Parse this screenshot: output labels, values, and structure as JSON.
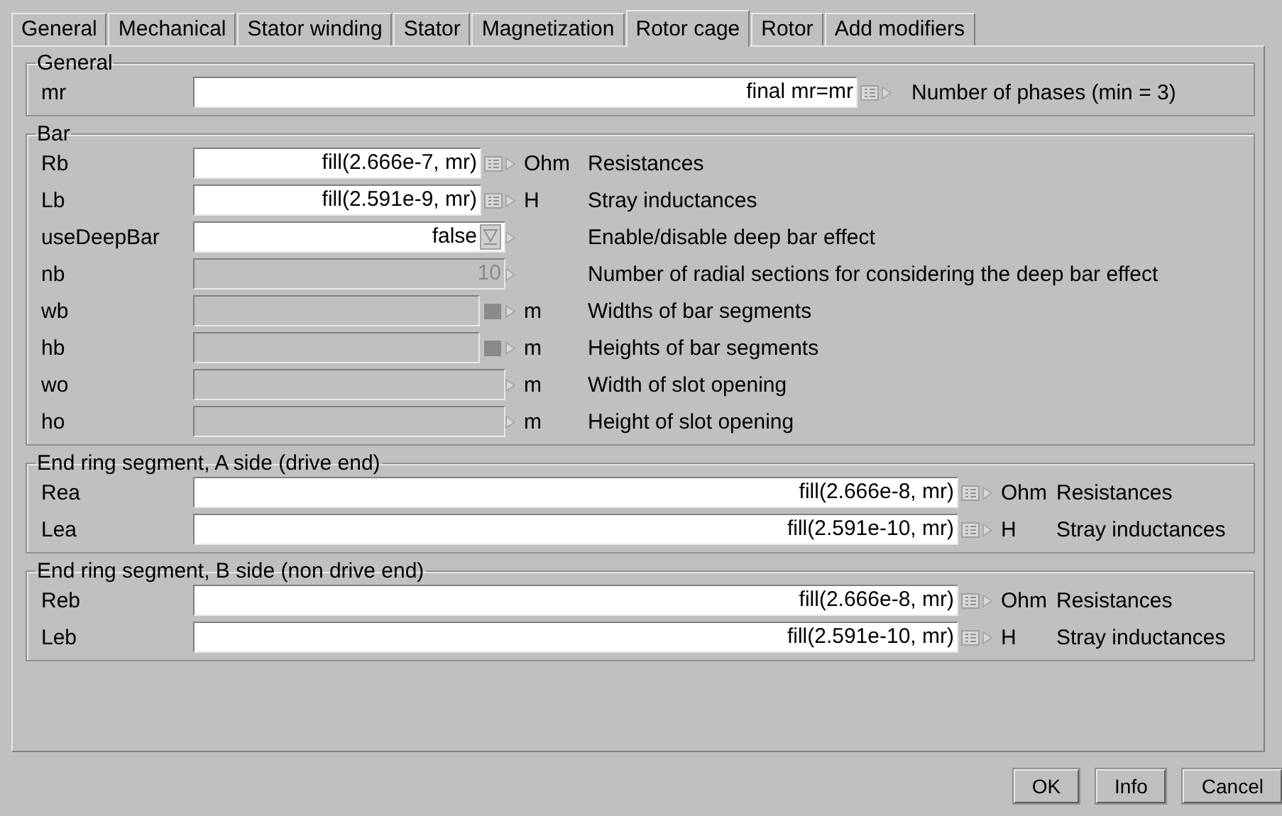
{
  "tabs": [
    {
      "label": "General",
      "selected": false
    },
    {
      "label": "Mechanical",
      "selected": false
    },
    {
      "label": "Stator winding",
      "selected": false
    },
    {
      "label": "Stator",
      "selected": false
    },
    {
      "label": "Magnetization",
      "selected": false
    },
    {
      "label": "Rotor cage",
      "selected": true
    },
    {
      "label": "Rotor",
      "selected": false
    },
    {
      "label": "Add modifiers",
      "selected": false
    }
  ],
  "groups": [
    {
      "title": "General",
      "kind": "wide",
      "rows": [
        {
          "name": "mr",
          "kind": "text",
          "value": "final mr=mr",
          "disabled": false,
          "description": "Number of phases (min = 3)"
        }
      ]
    },
    {
      "title": "Bar",
      "kind": "narrow",
      "rows": [
        {
          "name": "Rb",
          "kind": "text",
          "value": "fill(2.666e-7, mr)",
          "disabled": false,
          "unit": "Ohm",
          "description": "Resistances"
        },
        {
          "name": "Lb",
          "kind": "text",
          "value": "fill(2.591e-9, mr)",
          "disabled": false,
          "unit": "H",
          "description": "Stray inductances"
        },
        {
          "name": "useDeepBar",
          "kind": "choice",
          "value": "false",
          "disabled": false,
          "description": "Enable/disable deep bar effect"
        },
        {
          "name": "nb",
          "kind": "plain",
          "value": "10",
          "disabled": true,
          "description": "Number of radial sections for considering the deep bar effect"
        },
        {
          "name": "wb",
          "kind": "array",
          "disabled": true,
          "unit": "m",
          "description": "Widths of bar segments"
        },
        {
          "name": "hb",
          "kind": "array",
          "disabled": true,
          "unit": "m",
          "description": "Heights of bar segments"
        },
        {
          "name": "wo",
          "kind": "plain",
          "disabled": true,
          "unit": "m",
          "description": "Width of slot opening"
        },
        {
          "name": "ho",
          "kind": "plain",
          "disabled": true,
          "unit": "m",
          "description": "Height of slot opening"
        }
      ]
    },
    {
      "title": "End ring segment, A side (drive end)",
      "kind": "long",
      "rows": [
        {
          "name": "Rea",
          "kind": "text",
          "value": "fill(2.666e-8, mr)",
          "disabled": false,
          "unit": "Ohm",
          "description": "Resistances"
        },
        {
          "name": "Lea",
          "kind": "text",
          "value": "fill(2.591e-10, mr)",
          "disabled": false,
          "unit": "H",
          "description": "Stray inductances"
        }
      ]
    },
    {
      "title": "End ring segment, B side (non drive end)",
      "kind": "long",
      "rows": [
        {
          "name": "Reb",
          "kind": "text",
          "value": "fill(2.666e-8, mr)",
          "disabled": false,
          "unit": "Ohm",
          "description": "Resistances"
        },
        {
          "name": "Leb",
          "kind": "text",
          "value": "fill(2.591e-10, mr)",
          "disabled": false,
          "unit": "H",
          "description": "Stray inductances"
        }
      ]
    }
  ],
  "buttons": [
    "OK",
    "Info",
    "Cancel"
  ]
}
